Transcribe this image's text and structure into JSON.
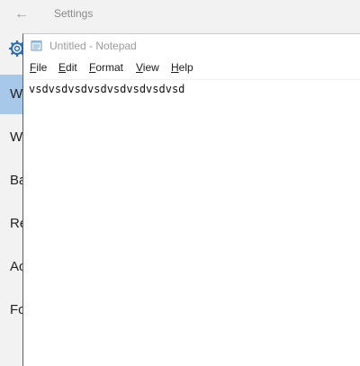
{
  "settings": {
    "title": "Settings",
    "nav": [
      {
        "letters": "W",
        "active": true
      },
      {
        "letters": "W",
        "active": false
      },
      {
        "letters": "Ba",
        "active": false
      },
      {
        "letters": "Re",
        "active": false
      },
      {
        "letters": "Ac",
        "active": false
      },
      {
        "letters": "Fo",
        "active": false
      }
    ],
    "accent": "#a7c8e8"
  },
  "notepad": {
    "title": "Untitled - Notepad",
    "menu": [
      {
        "mnemonic": "F",
        "rest": "ile"
      },
      {
        "mnemonic": "E",
        "rest": "dit"
      },
      {
        "mnemonic": "F",
        "pre": "",
        "rest": "ormat",
        "underline_index": 0
      },
      {
        "mnemonic": "V",
        "rest": "iew"
      },
      {
        "mnemonic": "H",
        "rest": "elp"
      }
    ],
    "content": "vsdvsdvsdvsdvsdvsdvsdvsd"
  }
}
